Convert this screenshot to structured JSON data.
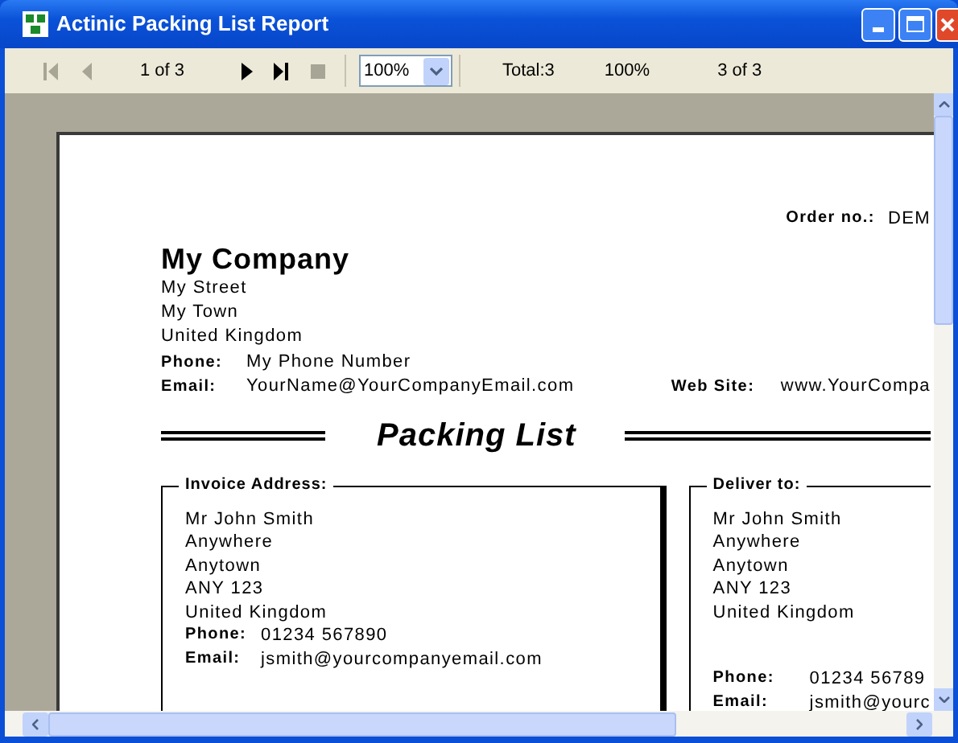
{
  "window": {
    "title": "Actinic Packing List Report"
  },
  "toolbar": {
    "back_buttons": [
      {
        "kind": "first",
        "disabled": true
      },
      {
        "kind": "previous",
        "disabled": true
      }
    ],
    "page_indicator": "1 of 3",
    "forward_buttons": [
      {
        "kind": "next",
        "disabled": false
      },
      {
        "kind": "last",
        "disabled": false
      },
      {
        "kind": "stop",
        "disabled": true
      }
    ],
    "zoom": "100%",
    "total": "Total:3",
    "zoom_status": "100%",
    "page_status": "3 of 3"
  },
  "report": {
    "order_label": "Order no.:",
    "order_value": "DEM",
    "company": {
      "name": "My Company",
      "address_lines": [
        "My Street",
        "My Town",
        "United Kingdom"
      ],
      "phone_label": "Phone:",
      "phone": "My Phone Number",
      "email_label": "Email:",
      "email": "YourName@YourCompanyEmail.com",
      "website_label": "Web Site:",
      "website": "www.YourCompa"
    },
    "title": "Packing List",
    "invoice_address": {
      "heading": "Invoice Address:",
      "lines": [
        "Mr John Smith",
        "Anywhere",
        "Anytown",
        "ANY 123",
        "United Kingdom"
      ],
      "phone_label": "Phone:",
      "phone": "01234 567890",
      "email_label": "Email:",
      "email": "jsmith@yourcompanyemail.com"
    },
    "deliver_to": {
      "heading": "Deliver to:",
      "lines": [
        "Mr John Smith",
        "Anywhere",
        "Anytown",
        "ANY 123",
        "United Kingdom"
      ],
      "phone_label": "Phone:",
      "phone": "01234 56789",
      "email_label": "Email:",
      "email": "jsmith@yourc"
    }
  }
}
